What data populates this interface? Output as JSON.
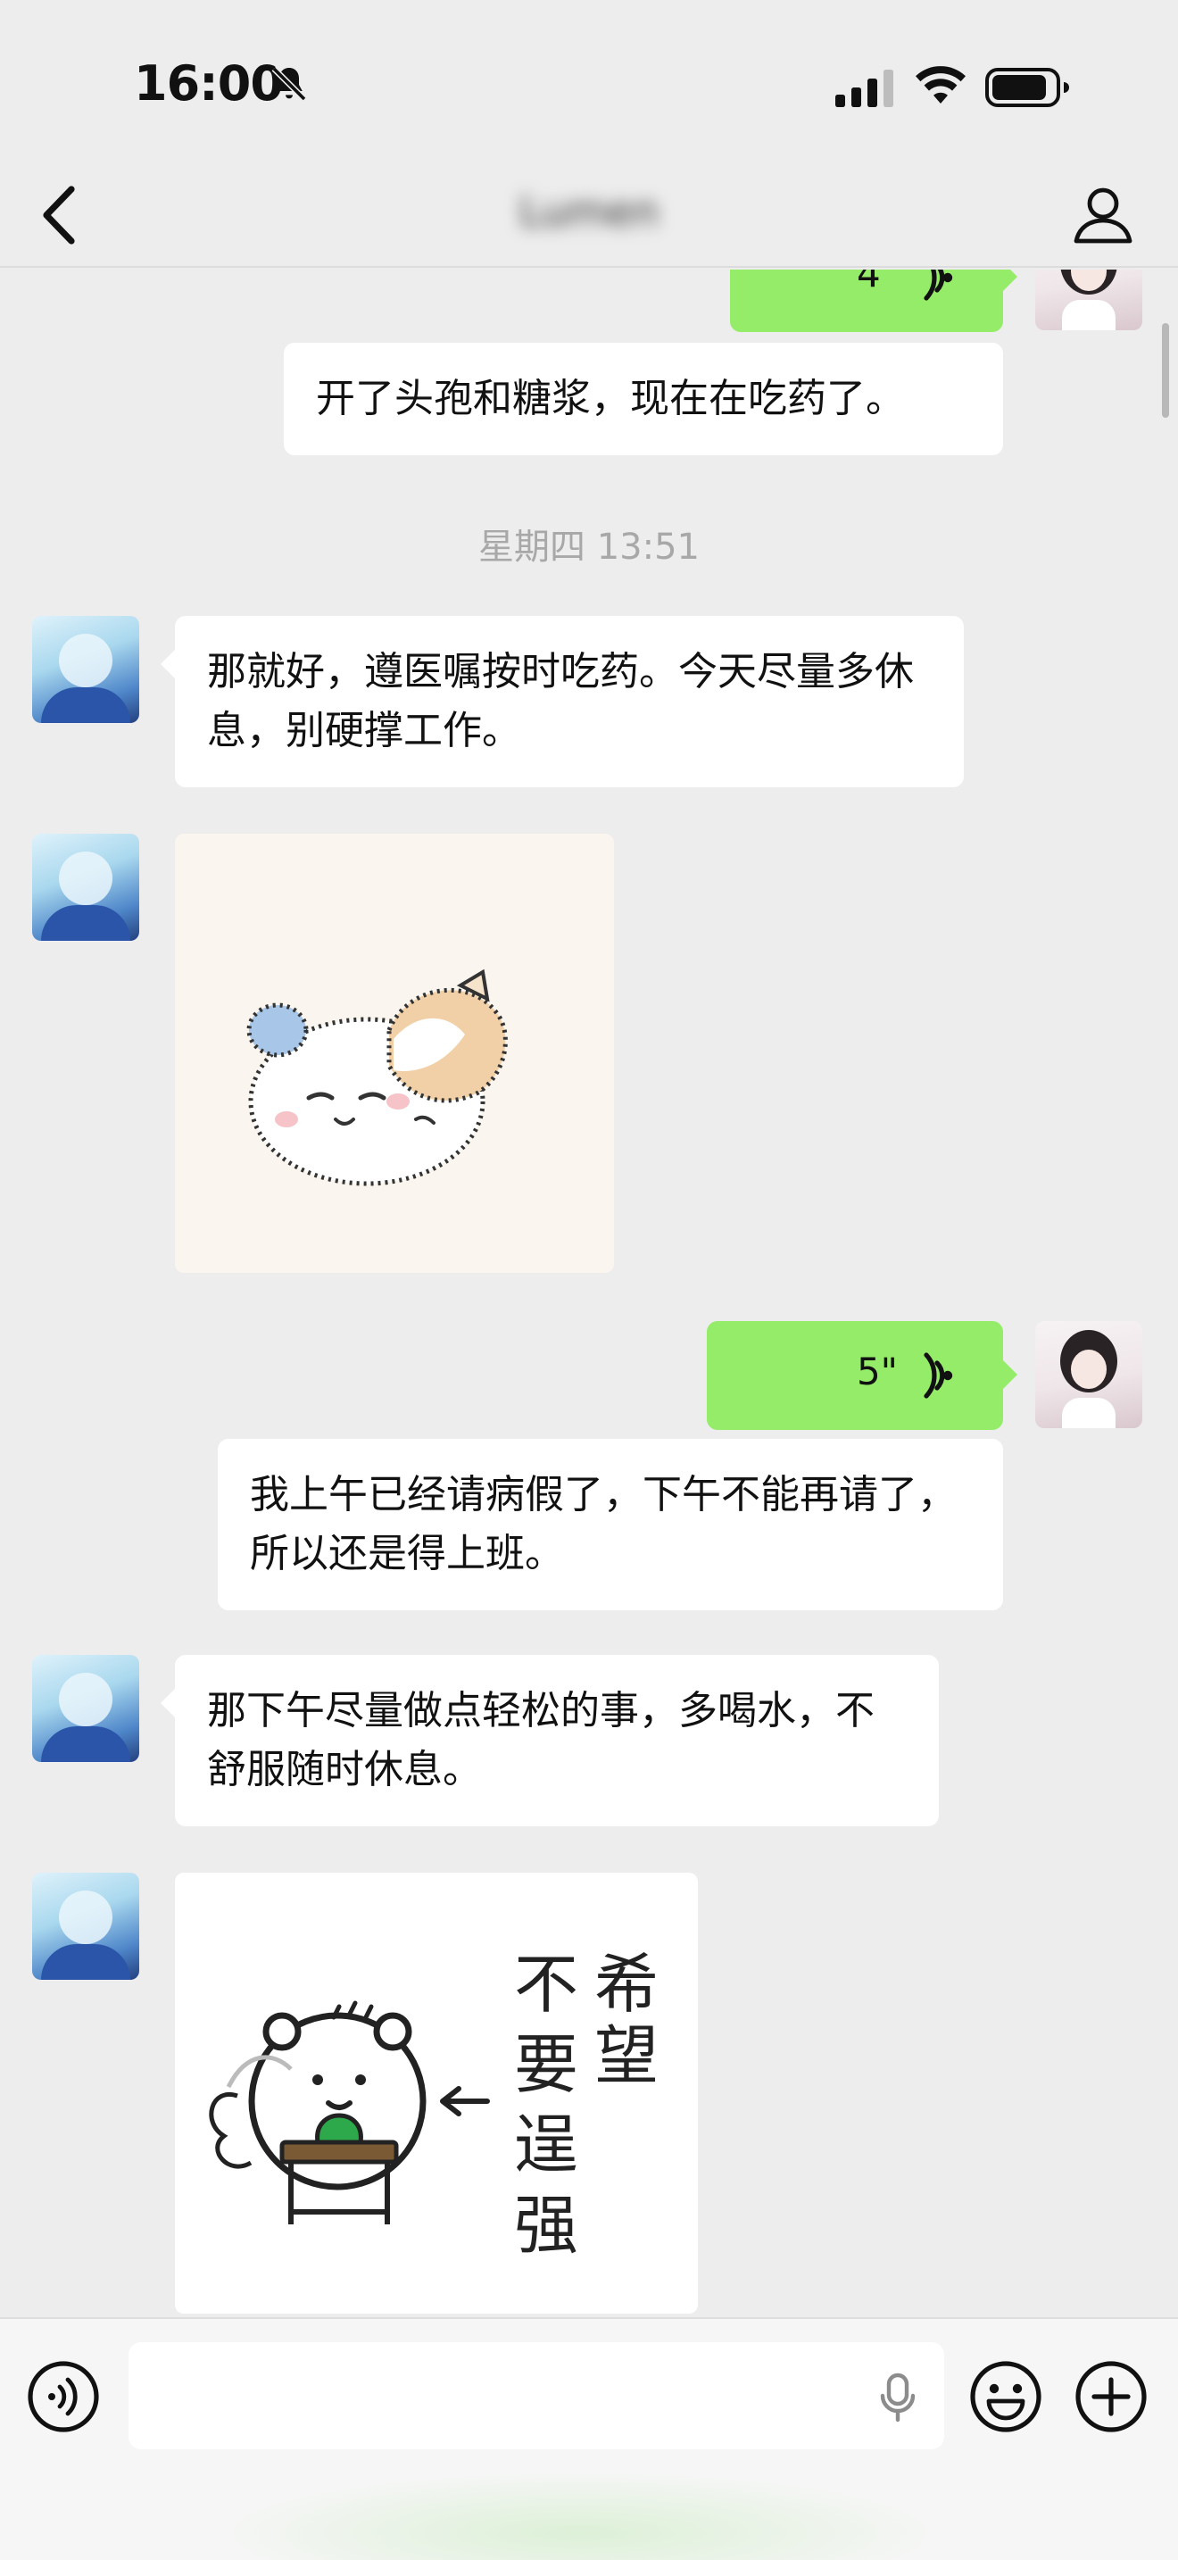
{
  "status_bar": {
    "time": "16:00"
  },
  "nav": {
    "title": "Lumen"
  },
  "messages": [
    {
      "type": "voice",
      "side": "right",
      "duration": "4\""
    },
    {
      "type": "text",
      "side": "right",
      "text": "开了头孢和糖浆，现在在吃药了。"
    },
    {
      "type": "timestamp",
      "text": "星期四 13:51"
    },
    {
      "type": "text",
      "side": "left",
      "text": "那就好，遵医嘱按时吃药。今天尽量多休息，别硬撑工作。"
    },
    {
      "type": "sticker",
      "side": "left",
      "description": "sleeping-cats-sticker"
    },
    {
      "type": "voice",
      "side": "right",
      "duration": "5\""
    },
    {
      "type": "text",
      "side": "right",
      "text": "我上午已经请病假了，下午不能再请了，所以还是得上班。"
    },
    {
      "type": "text",
      "side": "left",
      "text": "那下午尽量做点轻松的事，多喝水，不舒服随时休息。"
    },
    {
      "type": "sticker",
      "side": "left",
      "text": "希望不要逞强"
    }
  ],
  "input_bar": {
    "placeholder": ""
  },
  "colors": {
    "background": "#EDEDED",
    "outgoing": "#95EC69",
    "incoming": "#FFFFFF"
  }
}
